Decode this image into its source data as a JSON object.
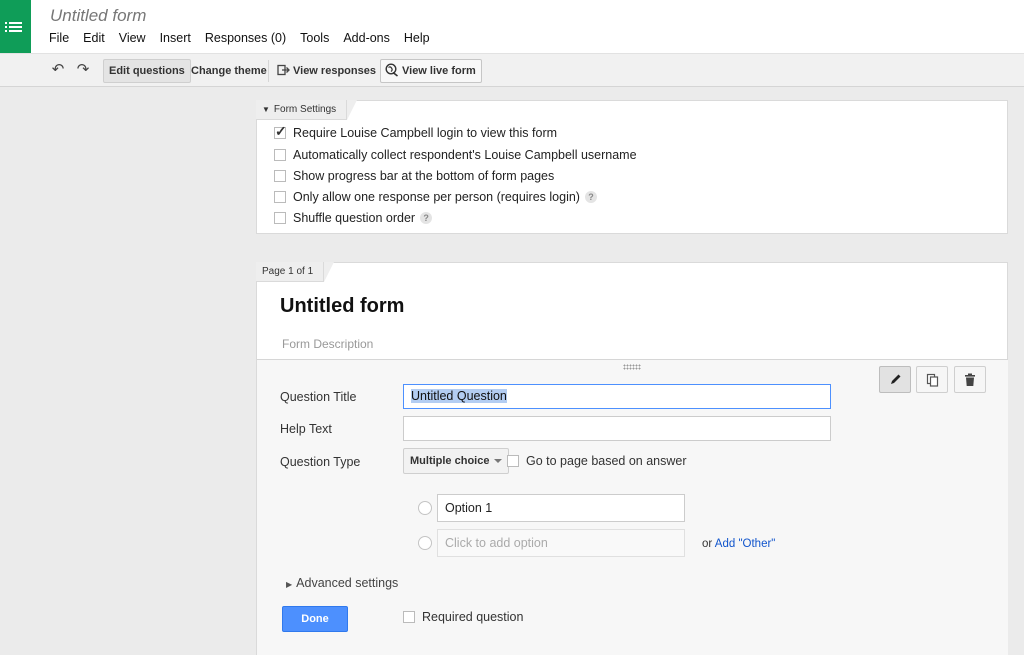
{
  "app": {
    "title": "Untitled form",
    "logo_icon": "forms-list-icon",
    "brand_color": "#0f9d58"
  },
  "menu": [
    "File",
    "Edit",
    "View",
    "Insert",
    "Responses (0)",
    "Tools",
    "Add-ons",
    "Help"
  ],
  "toolbar": {
    "undo_icon": "undo-icon",
    "redo_icon": "redo-icon",
    "edit_questions": "Edit questions",
    "change_theme": "Change theme",
    "view_responses": "View responses",
    "view_live_form": "View live form"
  },
  "form_settings": {
    "tab_label": "Form Settings",
    "options": [
      {
        "label": "Require Louise Campbell login to view this form",
        "checked": true,
        "help": false
      },
      {
        "label": "Automatically collect respondent's Louise Campbell username",
        "checked": false,
        "help": false
      },
      {
        "label": "Show progress bar at the bottom of form pages",
        "checked": false,
        "help": false
      },
      {
        "label": "Only allow one response per person (requires login)",
        "checked": false,
        "help": true
      },
      {
        "label": "Shuffle question order",
        "checked": false,
        "help": true
      }
    ],
    "help_glyph": "?"
  },
  "page": {
    "tab_label": "Page 1 of 1",
    "form_title": "Untitled form",
    "form_description": "Form Description"
  },
  "question": {
    "title_label": "Question Title",
    "title_value": "Untitled Question",
    "help_label": "Help Text",
    "help_value": "",
    "type_label": "Question Type",
    "type_value": "Multiple choice",
    "go_to_page_label": "Go to page based on answer",
    "option_1": "Option 1",
    "add_option_placeholder": "Click to add option",
    "or_text": "or",
    "add_other": "Add \"Other\"",
    "advanced_settings": "Advanced settings",
    "done": "Done",
    "required_label": "Required question",
    "tools": [
      "pencil-icon",
      "duplicate-icon",
      "trash-icon"
    ]
  }
}
